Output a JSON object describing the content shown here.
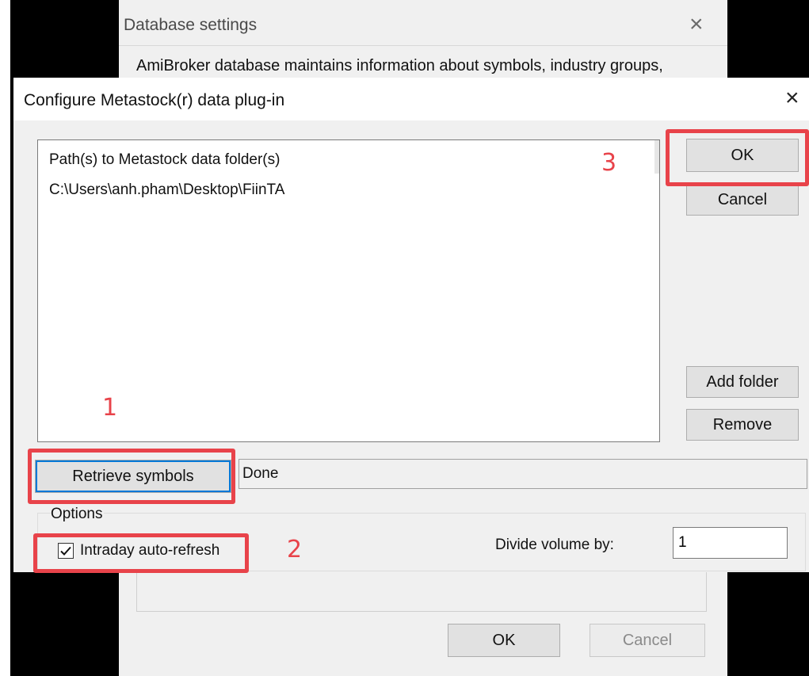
{
  "background_dialog": {
    "title": "Database settings",
    "description": "AmiBroker database maintains information about symbols, industry groups,",
    "ok_label": "OK",
    "cancel_label": "Cancel",
    "close_glyph": "×"
  },
  "dialog": {
    "title": "Configure Metastock(r) data plug-in",
    "close_glyph": "×",
    "paths_list": {
      "items": [
        "Path(s) to Metastock data folder(s)",
        "C:\\Users\\anh.pham\\Desktop\\FiinTA"
      ]
    },
    "buttons": {
      "ok": "OK",
      "cancel": "Cancel",
      "add_folder": "Add folder",
      "remove": "Remove",
      "retrieve_symbols": "Retrieve symbols"
    },
    "status_text": "Done",
    "options": {
      "group_label": "Options",
      "intraday_auto_refresh": {
        "label": "Intraday auto-refresh",
        "checked": true
      },
      "divide_volume": {
        "label": "Divide volume by:",
        "value": "1"
      }
    }
  },
  "annotations": {
    "step_1": "1",
    "step_2": "2",
    "step_3": "3",
    "color": "#e8434a"
  },
  "icons": {
    "close": "close-icon",
    "check": "checkmark-icon"
  }
}
